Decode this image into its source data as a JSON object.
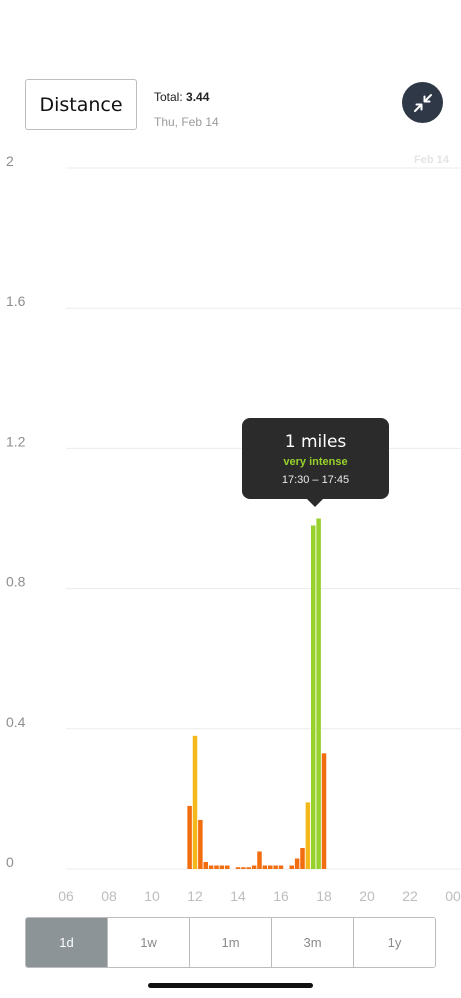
{
  "header": {
    "metric_label": "Distance",
    "total_label": "Total: ",
    "total_value": "3.44",
    "date": "Thu, Feb 14"
  },
  "colors": {
    "orange": "#f26d0f",
    "yellow": "#f5b81c",
    "green": "#97d12b",
    "grid": "#ececec",
    "tooltip_bg": "#2b2b2b"
  },
  "icons": {
    "collapse": "collapse-arrows-icon"
  },
  "chart_data": {
    "type": "bar",
    "ylim": [
      0,
      2
    ],
    "yticks": [
      "2",
      "1.6",
      "1.2",
      "0.8",
      "0.4",
      "0"
    ],
    "xticks": [
      "06",
      "08",
      "10",
      "12",
      "14",
      "16",
      "18",
      "20",
      "22",
      "00"
    ],
    "date_marker": "Feb 14",
    "x_unit": "hour",
    "bars": [
      {
        "hour": 11.75,
        "value": 0.18,
        "zone": "orange"
      },
      {
        "hour": 12.0,
        "value": 0.38,
        "zone": "yellow"
      },
      {
        "hour": 12.25,
        "value": 0.14,
        "zone": "orange"
      },
      {
        "hour": 12.5,
        "value": 0.02,
        "zone": "orange"
      },
      {
        "hour": 12.75,
        "value": 0.01,
        "zone": "orange"
      },
      {
        "hour": 13.0,
        "value": 0.01,
        "zone": "orange"
      },
      {
        "hour": 13.25,
        "value": 0.01,
        "zone": "orange"
      },
      {
        "hour": 13.5,
        "value": 0.01,
        "zone": "orange"
      },
      {
        "hour": 14.0,
        "value": 0.005,
        "zone": "orange"
      },
      {
        "hour": 14.25,
        "value": 0.005,
        "zone": "orange"
      },
      {
        "hour": 14.5,
        "value": 0.005,
        "zone": "orange"
      },
      {
        "hour": 14.75,
        "value": 0.01,
        "zone": "orange"
      },
      {
        "hour": 15.0,
        "value": 0.05,
        "zone": "orange"
      },
      {
        "hour": 15.25,
        "value": 0.01,
        "zone": "orange"
      },
      {
        "hour": 15.5,
        "value": 0.01,
        "zone": "orange"
      },
      {
        "hour": 15.75,
        "value": 0.01,
        "zone": "orange"
      },
      {
        "hour": 16.0,
        "value": 0.01,
        "zone": "orange"
      },
      {
        "hour": 16.5,
        "value": 0.01,
        "zone": "orange"
      },
      {
        "hour": 16.75,
        "value": 0.03,
        "zone": "orange"
      },
      {
        "hour": 17.0,
        "value": 0.06,
        "zone": "orange"
      },
      {
        "hour": 17.25,
        "value": 0.19,
        "zone": "yellow"
      },
      {
        "hour": 17.5,
        "value": 0.98,
        "zone": "green"
      },
      {
        "hour": 17.75,
        "value": 1.0,
        "zone": "green"
      },
      {
        "hour": 18.0,
        "value": 0.33,
        "zone": "orange"
      }
    ]
  },
  "tooltip": {
    "value": "1 miles",
    "zone": "very intense",
    "time": "17:30 – 17:45"
  },
  "range_tabs": [
    {
      "label": "1d",
      "active": true
    },
    {
      "label": "1w",
      "active": false
    },
    {
      "label": "1m",
      "active": false
    },
    {
      "label": "3m",
      "active": false
    },
    {
      "label": "1y",
      "active": false
    }
  ]
}
